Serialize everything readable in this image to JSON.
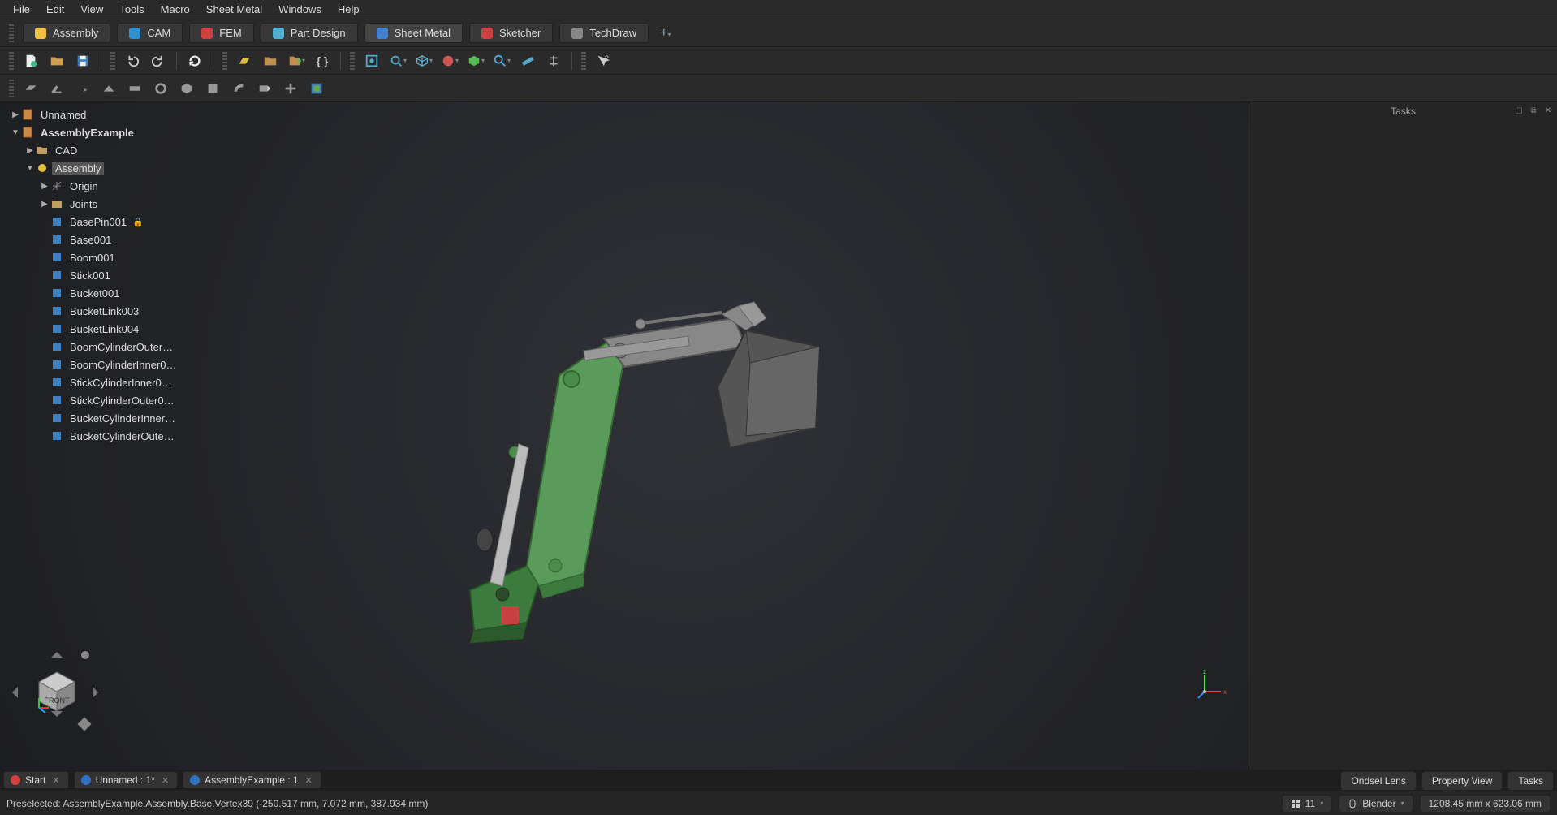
{
  "menu": [
    "File",
    "Edit",
    "View",
    "Tools",
    "Macro",
    "Sheet Metal",
    "Windows",
    "Help"
  ],
  "workbenches": [
    {
      "label": "Assembly",
      "color": "#f0c040"
    },
    {
      "label": "CAM",
      "color": "#3090d0"
    },
    {
      "label": "FEM",
      "color": "#d04040"
    },
    {
      "label": "Part Design",
      "color": "#50b0d0"
    },
    {
      "label": "Sheet Metal",
      "color": "#4080d0",
      "active": true
    },
    {
      "label": "Sketcher",
      "color": "#d04040"
    },
    {
      "label": "TechDraw",
      "color": "#888"
    }
  ],
  "tree": {
    "roots": [
      {
        "label": "Unnamed",
        "expanded": false,
        "icon": "doc",
        "depth": 0
      },
      {
        "label": "AssemblyExample",
        "expanded": true,
        "icon": "doc",
        "depth": 0,
        "bold": true
      }
    ],
    "children": [
      {
        "label": "CAD",
        "depth": 1,
        "arrow": "▶",
        "icon": "folder"
      },
      {
        "label": "Assembly",
        "depth": 1,
        "arrow": "▼",
        "icon": "asm",
        "sel": true
      },
      {
        "label": "Origin",
        "depth": 2,
        "arrow": "▶",
        "icon": "origin"
      },
      {
        "label": "Joints",
        "depth": 2,
        "arrow": "▶",
        "icon": "folder"
      },
      {
        "label": "BasePin001",
        "depth": 2,
        "icon": "part",
        "lock": true
      },
      {
        "label": "Base001",
        "depth": 2,
        "icon": "part"
      },
      {
        "label": "Boom001",
        "depth": 2,
        "icon": "part"
      },
      {
        "label": "Stick001",
        "depth": 2,
        "icon": "part"
      },
      {
        "label": "Bucket001",
        "depth": 2,
        "icon": "part"
      },
      {
        "label": "BucketLink003",
        "depth": 2,
        "icon": "part"
      },
      {
        "label": "BucketLink004",
        "depth": 2,
        "icon": "part"
      },
      {
        "label": "BoomCylinderOuter…",
        "depth": 2,
        "icon": "part"
      },
      {
        "label": "BoomCylinderInner0…",
        "depth": 2,
        "icon": "part"
      },
      {
        "label": "StickCylinderInner0…",
        "depth": 2,
        "icon": "part"
      },
      {
        "label": "StickCylinderOuter0…",
        "depth": 2,
        "icon": "part"
      },
      {
        "label": "BucketCylinderInner…",
        "depth": 2,
        "icon": "part"
      },
      {
        "label": "BucketCylinderOute…",
        "depth": 2,
        "icon": "part"
      }
    ]
  },
  "doctabs": [
    {
      "label": "Start",
      "color": "#d04040"
    },
    {
      "label": "Unnamed : 1*",
      "color": "#3070c0"
    },
    {
      "label": "AssemblyExample : 1",
      "color": "#3070c0"
    }
  ],
  "viewtabs": [
    "Ondsel Lens",
    "Property View",
    "Tasks"
  ],
  "tasks_title": "Tasks",
  "status": {
    "preselect": "Preselected: AssemblyExample.Assembly.Base.Vertex39 (-250.517 mm, 7.072 mm, 387.934 mm)",
    "count": "11",
    "navstyle": "Blender",
    "dims": "1208.45 mm x 623.06 mm"
  },
  "navcube_face": "FRONT"
}
